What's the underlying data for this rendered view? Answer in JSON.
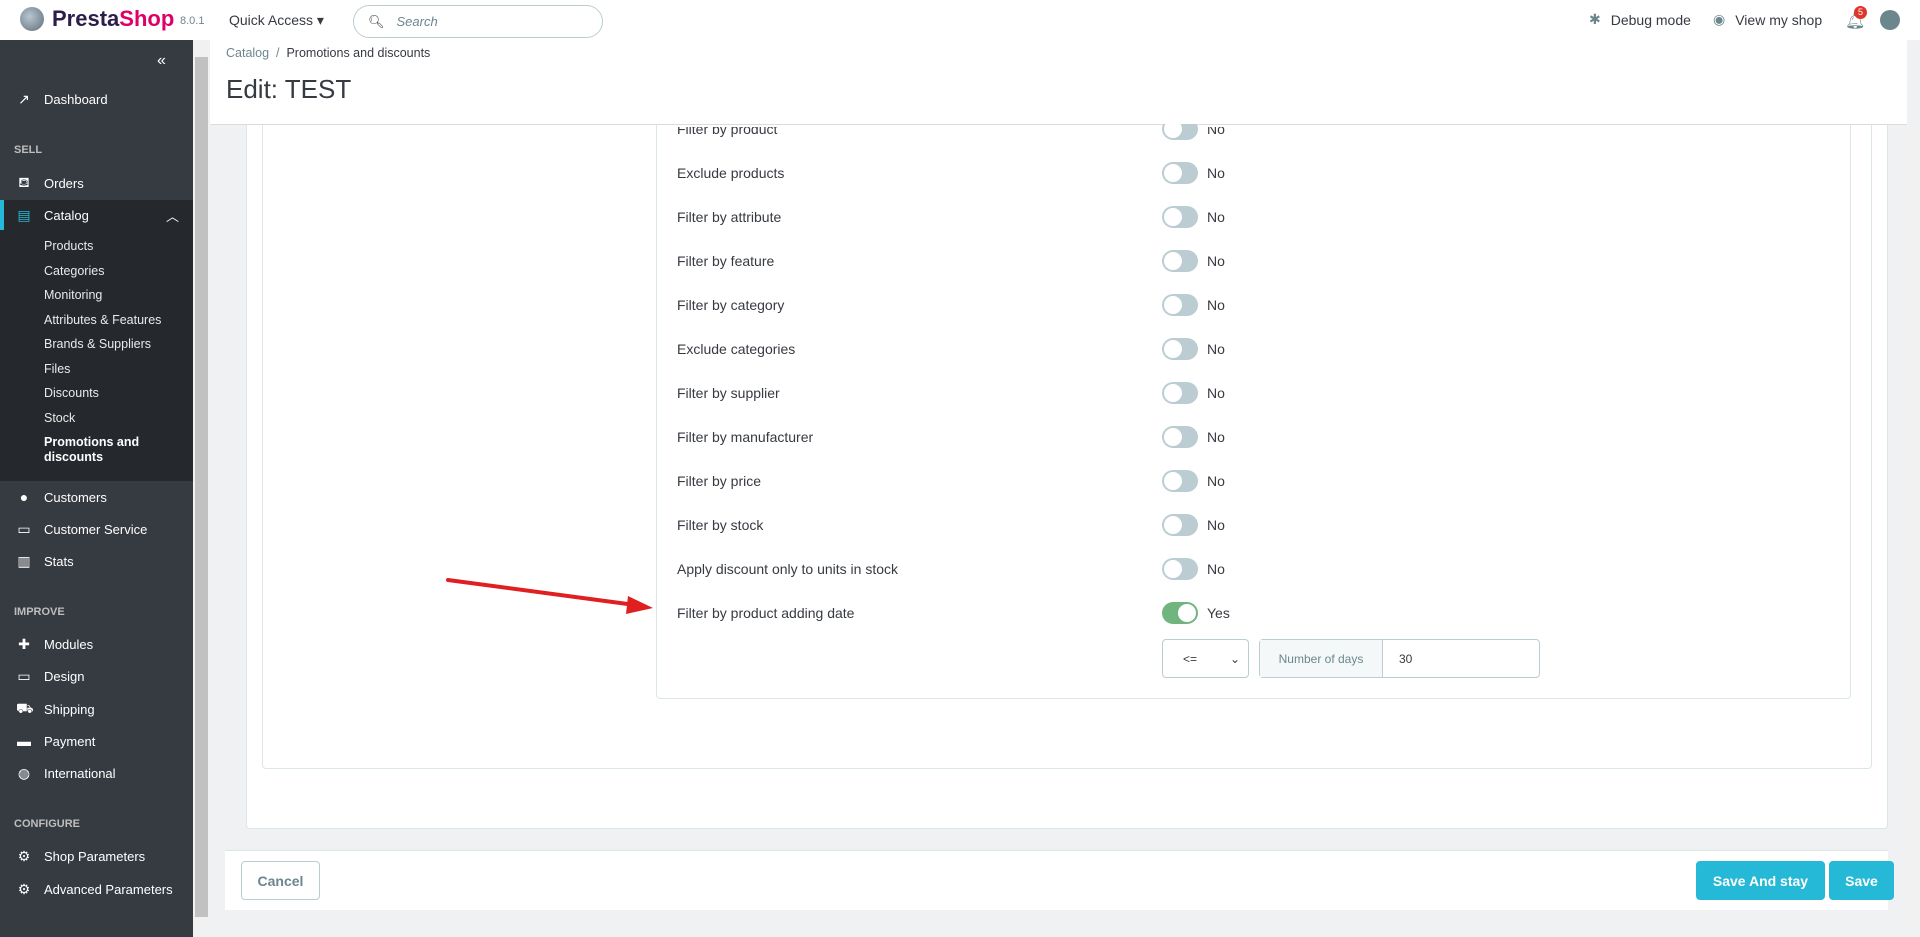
{
  "topbar": {
    "brand_a": "Presta",
    "brand_b": "Shop",
    "version": "8.0.1",
    "quick_access": "Quick Access",
    "search_placeholder": "Search",
    "debug_mode": "Debug mode",
    "view_shop": "View my shop",
    "notifications": "5"
  },
  "sidebar": {
    "dashboard": "Dashboard",
    "sell": "SELL",
    "orders": "Orders",
    "catalog": "Catalog",
    "catalog_items": [
      "Products",
      "Categories",
      "Monitoring",
      "Attributes & Features",
      "Brands & Suppliers",
      "Files",
      "Discounts",
      "Stock",
      "Promotions and",
      "discounts"
    ],
    "customers": "Customers",
    "customer_service": "Customer Service",
    "stats": "Stats",
    "improve": "IMPROVE",
    "modules": "Modules",
    "design": "Design",
    "shipping": "Shipping",
    "payment": "Payment",
    "international": "International",
    "configure": "CONFIGURE",
    "shop_parameters": "Shop Parameters",
    "advanced_parameters": "Advanced Parameters"
  },
  "breadcrumb": {
    "parent": "Catalog",
    "current": "Promotions and discounts"
  },
  "page_title": "Edit: TEST",
  "filters": [
    {
      "label": "Filter by product",
      "value": "No",
      "on": false
    },
    {
      "label": "Exclude products",
      "value": "No",
      "on": false
    },
    {
      "label": "Filter by attribute",
      "value": "No",
      "on": false
    },
    {
      "label": "Filter by feature",
      "value": "No",
      "on": false
    },
    {
      "label": "Filter by category",
      "value": "No",
      "on": false
    },
    {
      "label": "Exclude categories",
      "value": "No",
      "on": false
    },
    {
      "label": "Filter by supplier",
      "value": "No",
      "on": false
    },
    {
      "label": "Filter by manufacturer",
      "value": "No",
      "on": false
    },
    {
      "label": "Filter by price",
      "value": "No",
      "on": false
    },
    {
      "label": "Filter by stock",
      "value": "No",
      "on": false
    },
    {
      "label": "Apply discount only to units in stock",
      "value": "No",
      "on": false
    },
    {
      "label": "Filter by product adding date",
      "value": "Yes",
      "on": true
    }
  ],
  "date_filter": {
    "operator": "<=",
    "addon": "Number of days",
    "days": "30"
  },
  "footer": {
    "cancel": "Cancel",
    "save_stay": "Save And stay",
    "save": "Save"
  },
  "colors": {
    "accent": "#25b9d7",
    "sidebar": "#363a41",
    "toggle_on": "#70b580",
    "arrow": "#e02020"
  }
}
